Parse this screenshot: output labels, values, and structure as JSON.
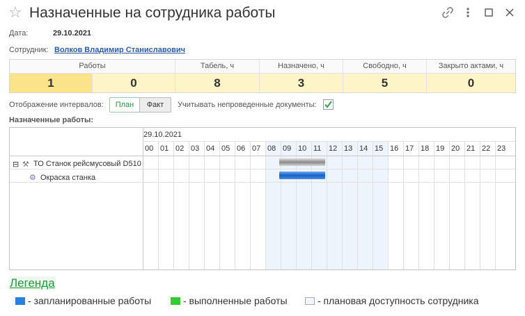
{
  "window": {
    "title": "Назначенные на сотрудника работы"
  },
  "form": {
    "date_label": "Дата:",
    "date_value": "29.10.2021",
    "employee_label": "Сотрудник:",
    "employee_value": "Волков Владимир Станиславович"
  },
  "stats": [
    {
      "label": "Работы",
      "value": "1"
    },
    {
      "label": "",
      "value": "0"
    },
    {
      "label": "Табель, ч",
      "value": "8"
    },
    {
      "label": "Назначено, ч",
      "value": "3"
    },
    {
      "label": "Свободно, ч",
      "value": "5"
    },
    {
      "label": "Закрыто актами, ч",
      "value": "0"
    }
  ],
  "intervals": {
    "label": "Отображение интервалов:",
    "plan": "План",
    "fact": "Факт",
    "include_label": "Учитывать непроведенные документы:",
    "include_checked": true
  },
  "section_title": "Назначенные работы:",
  "gantt": {
    "date": "29.10.2021",
    "hours": [
      "00",
      "01",
      "02",
      "03",
      "04",
      "05",
      "06",
      "07",
      "08",
      "09",
      "10",
      "11",
      "12",
      "13",
      "14",
      "15",
      "16",
      "17",
      "18",
      "19",
      "20",
      "21",
      "22",
      "23"
    ],
    "availability": {
      "from": 8,
      "to": 16
    },
    "rows": [
      {
        "expander": "⊟",
        "label": "ТО Станок рейсмусовый D510",
        "bar_from": 9,
        "bar_to": 12,
        "bar_kind": "summary"
      },
      {
        "expander": "",
        "label": "Окраска станка",
        "bar_from": 9,
        "bar_to": 12,
        "bar_kind": "planned"
      }
    ]
  },
  "legend": {
    "title": "Легенда",
    "items": [
      {
        "color": "#2a80e0",
        "text": "- запланированные работы"
      },
      {
        "color": "#33cc33",
        "text": "- выполненные работы"
      },
      {
        "color": "#f2f6fb",
        "text": "- плановая доступность сотрудника"
      }
    ]
  }
}
